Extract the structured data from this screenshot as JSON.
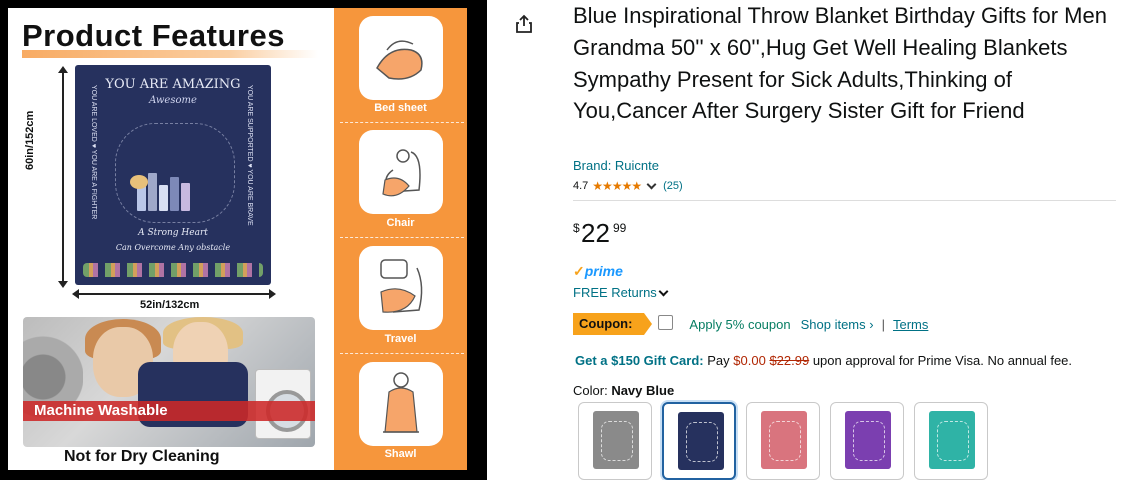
{
  "image_panel": {
    "title": "Product Features",
    "blanket": {
      "heading": "YOU ARE AMAZING",
      "subheading": "Awesome",
      "left_side": "YOU ARE LOVED ♥ YOU ARE A FIGHTER",
      "right_side": "YOU ARE SUPPORTED ♥ YOU ARE BRAVE",
      "strong_line": "A Strong Heart",
      "overcome_line": "Can Overcome Any obstacle"
    },
    "height_label": "60in/152cm",
    "width_label": "52in/132cm",
    "washable_label": "Machine Washable",
    "dry_clean_label": "Not for Dry Cleaning",
    "features": [
      {
        "label": "Bed sheet",
        "icon": "bed-sheet-icon"
      },
      {
        "label": "Chair",
        "icon": "chair-icon"
      },
      {
        "label": "Travel",
        "icon": "travel-icon"
      },
      {
        "label": "Shawl",
        "icon": "shawl-icon"
      }
    ],
    "colors": {
      "orange": "#f6963c",
      "navy": "#26315e"
    }
  },
  "product": {
    "title": "Blue Inspirational Throw Blanket Birthday Gifts for Men Grandma 50'' x 60'',Hug Get Well Healing Blankets Sympathy Present for Sick Adults,Thinking of You,Cancer After Surgery Sister Gift for Friend",
    "brand": "Brand: Ruicnte",
    "rating": "4.7",
    "stars": "★★★★★",
    "review_count": "(25)",
    "price": {
      "currency": "$",
      "whole": "22",
      "fraction": "99"
    },
    "prime_label": "prime",
    "free_returns": "FREE Returns",
    "coupon": {
      "tag": "Coupon:",
      "apply_text": "Apply 5% coupon",
      "shop_items": "Shop items ›",
      "separator": "|",
      "terms": "Terms"
    },
    "gift_card": {
      "bold": "Get a $150 Gift Card:",
      "pay": "Pay",
      "new_price": "$0.00",
      "old_price": "$22.99",
      "rest": "upon approval for Prime Visa. No annual fee."
    },
    "color_label": "Color:",
    "color_value": "Navy Blue",
    "swatches": [
      {
        "name": "gray",
        "color": "#8a8a8a",
        "selected": false
      },
      {
        "name": "navy",
        "color": "#26315e",
        "selected": true
      },
      {
        "name": "pink",
        "color": "#d9747e",
        "selected": false
      },
      {
        "name": "purple",
        "color": "#7b3fb0",
        "selected": false
      },
      {
        "name": "teal",
        "color": "#2fb3a6",
        "selected": false
      }
    ]
  }
}
